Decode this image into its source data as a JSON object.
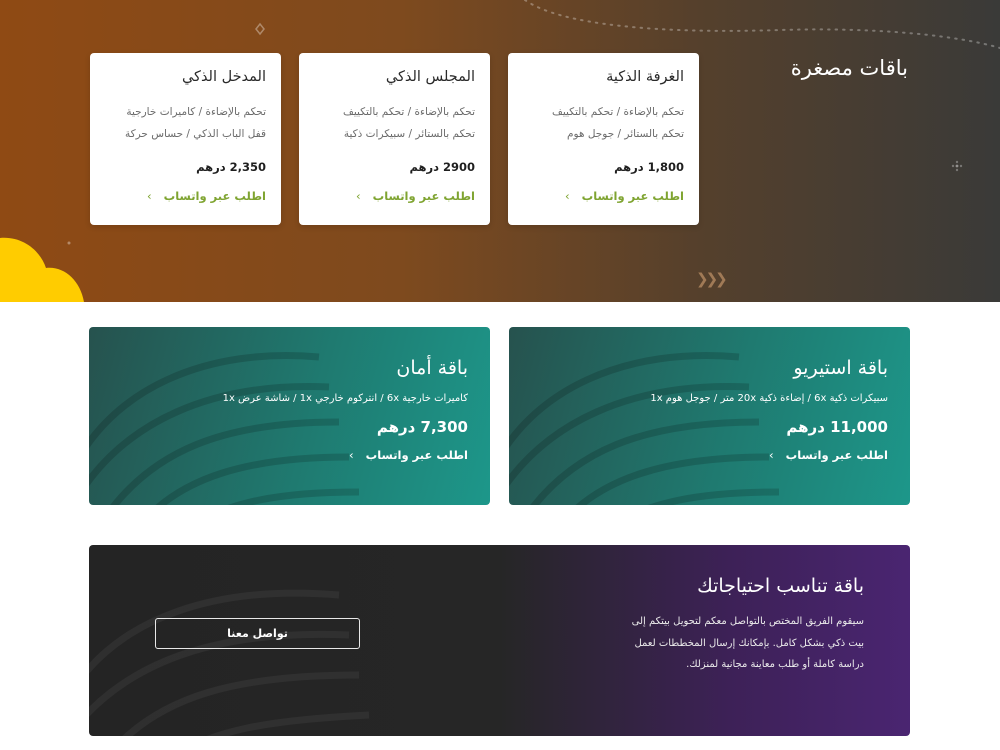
{
  "colors": {
    "hero_start": "#8f4a14",
    "hero_end": "#3a3a38",
    "teal": "#1f7a70",
    "purple": "#4a2571",
    "dark": "#242424",
    "cta_green": "#7fa431",
    "yellow_blob": "#ffcc00"
  },
  "hero": {
    "title": "باقات مصغرة",
    "chevrons": "❯❯❯"
  },
  "mini_packages": [
    {
      "title": "الغرفة الذكية",
      "line1": "تحكم بالإضاءة / تحكم بالتكييف",
      "line2": "تحكم بالستائر / جوجل هوم",
      "price": "1,800 درهم",
      "cta": "اطلب عبر واتساب",
      "arrow": "›"
    },
    {
      "title": "المجلس الذكي",
      "line1": "تحكم بالإضاءة / تحكم بالتكييف",
      "line2": "تحكم بالستائر / سبيكرات ذكية",
      "price": "2900 درهم",
      "cta": "اطلب عبر واتساب",
      "arrow": "›"
    },
    {
      "title": "المدخل الذكي",
      "line1": "تحكم بالإضاءة / كاميرات خارجية",
      "line2": "قفل الباب الذكي / حساس حركة",
      "price": "2,350 درهم",
      "cta": "اطلب عبر واتساب",
      "arrow": "›"
    }
  ],
  "big_packages": [
    {
      "title": "باقة استيريو",
      "desc": "سبيكرات ذكية 6x / إضاءة ذكية 20x متر / جوجل هوم 1x",
      "price": "11,000 درهم",
      "cta": "اطلب عبر واتساب",
      "arrow": "›"
    },
    {
      "title": "باقة أمان",
      "desc": "كاميرات خارجية 6x / انتركوم خارجي 1x / شاشة عرض 1x",
      "price": "7,300 درهم",
      "cta": "اطلب عبر واتساب",
      "arrow": "›"
    }
  ],
  "custom_package": {
    "title": "باقة تناسب احتياجاتك",
    "description": "سيقوم الفريق المختص بالتواصل معكم لتحويل بيتكم إلى بيت ذكي بشكل كامل. بإمكانك إرسال المخططات لعمل دراسة كاملة أو طلب معاينة مجانية لمنزلك.",
    "button": "تواصل معنا"
  }
}
